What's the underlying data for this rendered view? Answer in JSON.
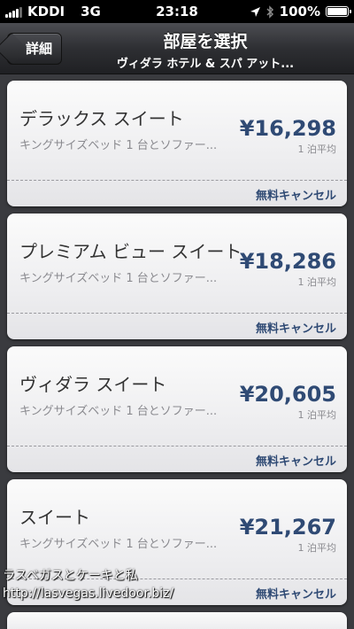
{
  "status_bar": {
    "carrier": "KDDI",
    "network": "3G",
    "time": "23:18",
    "battery": "100%"
  },
  "nav": {
    "back_label": "詳細",
    "title": "部屋を選択",
    "subtitle": "ヴィダラ ホテル & スパ アット..."
  },
  "rooms": [
    {
      "name": "デラックス スイート",
      "description": "キングサイズベッド 1 台とソファー...",
      "price": "¥16,298",
      "price_note": "1 泊平均",
      "cancel": "無料キャンセル"
    },
    {
      "name": "プレミアム ビュー スイート",
      "description": "キングサイズベッド 1 台とソファー...",
      "price": "¥18,286",
      "price_note": "1 泊平均",
      "cancel": "無料キャンセル"
    },
    {
      "name": "ヴィダラ スイート",
      "description": "キングサイズベッド 1 台とソファー...",
      "price": "¥20,605",
      "price_note": "1 泊平均",
      "cancel": "無料キャンセル"
    },
    {
      "name": "スイート",
      "description": "キングサイズベッド 1 台とソファー...",
      "price": "¥21,267",
      "price_note": "1 泊平均",
      "cancel": "無料キャンセル"
    }
  ],
  "watermark": {
    "line1": "ラスベガスとケーキと私",
    "line2": "http://lasvegas.livedoor.biz/"
  }
}
